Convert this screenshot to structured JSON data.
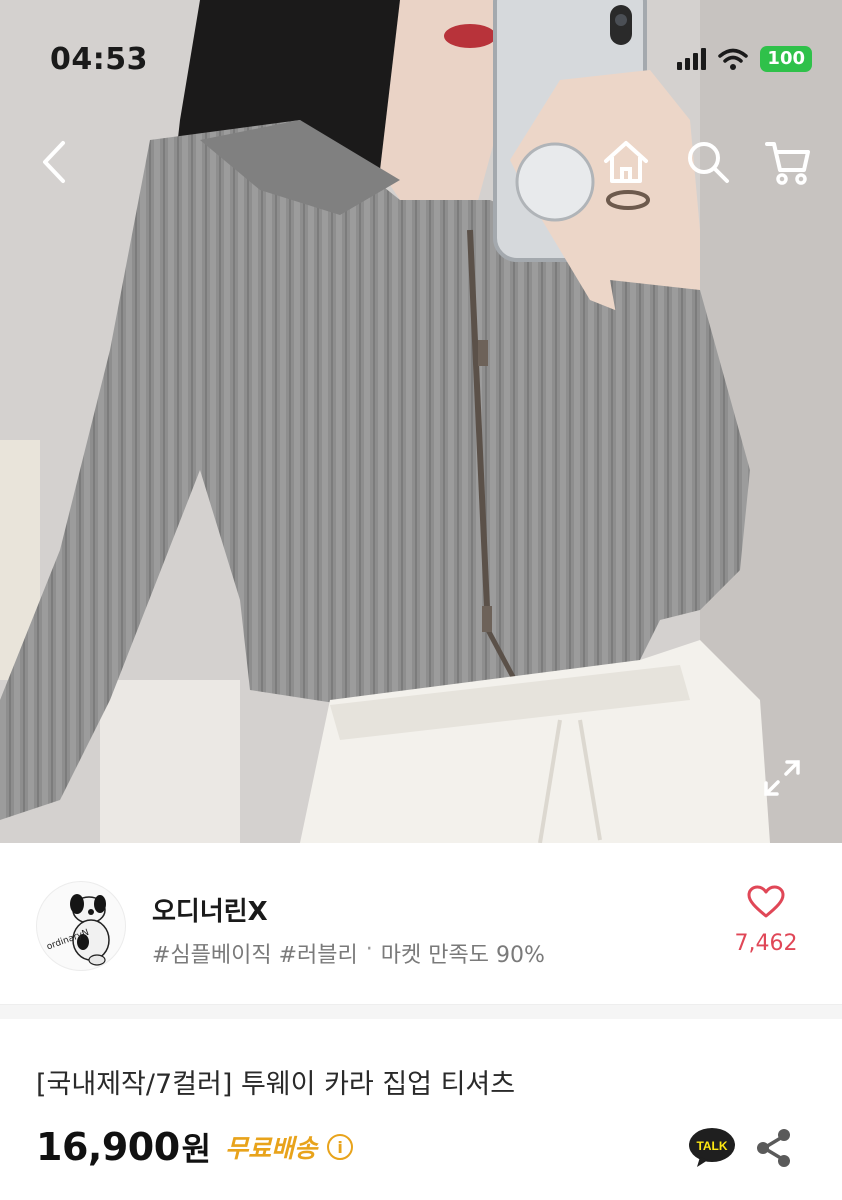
{
  "status_bar": {
    "time": "04:53",
    "battery": "100",
    "icons": [
      "signal-icon",
      "wifi-icon",
      "battery-icon"
    ]
  },
  "nav": {
    "icons": [
      "back-icon",
      "home-icon",
      "search-icon",
      "cart-icon"
    ]
  },
  "gallery": {
    "expand_icon": "expand-icon"
  },
  "shop": {
    "name": "오디너린X",
    "logo_text": "ordinaryN",
    "tags": "#심플베이직 #러블리",
    "separator": "·",
    "satisfaction": "마켓 만족도 90%",
    "like_count": "7,462",
    "like_icon": "heart-icon"
  },
  "product": {
    "title": "[국내제작/7컬러] 투웨이 카라 집업 티셔츠",
    "price": "16,900",
    "currency": "원",
    "free_shipping": "무료배송",
    "info_glyph": "i",
    "talk_label": "TALK",
    "share_icon": "share-icon"
  },
  "colors": {
    "accent_like": "#e04757",
    "free_shipping": "#e8a31b",
    "battery": "#2fc14a"
  }
}
